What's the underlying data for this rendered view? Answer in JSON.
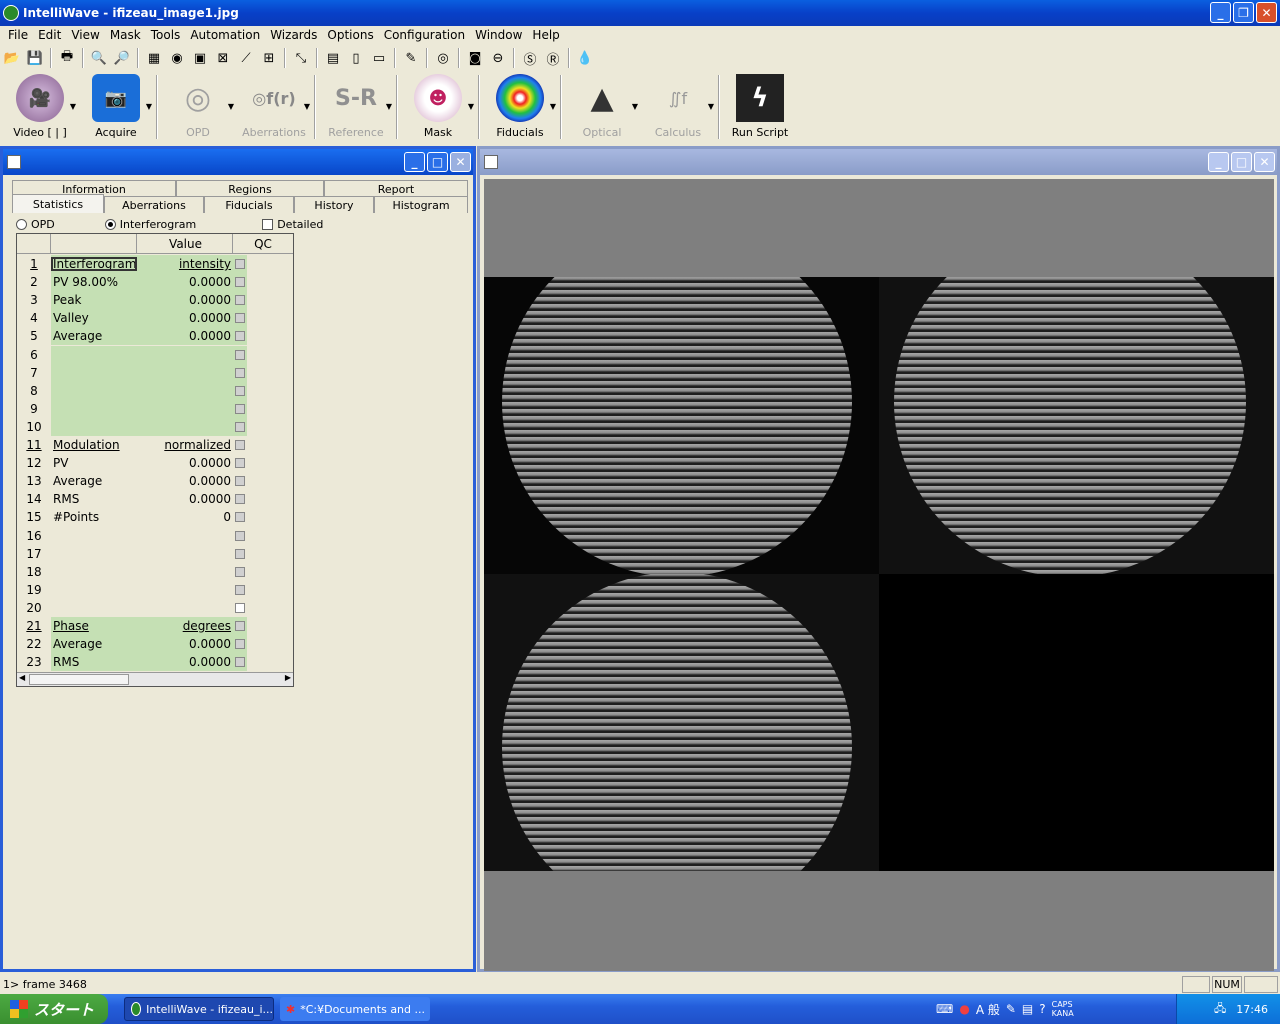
{
  "window": {
    "title": "IntelliWave - ifizeau_image1.jpg"
  },
  "menu": [
    "File",
    "Edit",
    "View",
    "Mask",
    "Tools",
    "Automation",
    "Wizards",
    "Options",
    "Configuration",
    "Window",
    "Help"
  ],
  "big_toolbar": [
    {
      "label": "Video [ | ]",
      "icon": "video-camera-icon",
      "enabled": true
    },
    {
      "label": "Acquire",
      "icon": "camera-icon",
      "enabled": true
    },
    {
      "label": "OPD",
      "icon": "opd-icon",
      "enabled": false
    },
    {
      "label": "Aberrations",
      "icon": "aberrations-icon",
      "enabled": false
    },
    {
      "label": "Reference",
      "icon": "reference-icon",
      "icon_text": "S-R",
      "enabled": false
    },
    {
      "label": "Mask",
      "icon": "mask-icon",
      "enabled": true
    },
    {
      "label": "Fiducials",
      "icon": "fiducials-icon",
      "enabled": true
    },
    {
      "label": "Optical",
      "icon": "optical-icon",
      "enabled": false
    },
    {
      "label": "Calculus",
      "icon": "calculus-icon",
      "enabled": false
    },
    {
      "label": "Run Script",
      "icon": "lightning-icon",
      "enabled": true
    }
  ],
  "stats_panel": {
    "tabs_back": [
      "Information",
      "Regions",
      "Report"
    ],
    "tabs_front": [
      "Statistics",
      "Aberrations",
      "Fiducials",
      "History",
      "Histogram"
    ],
    "active_tab": "Statistics",
    "radio_opd": "OPD",
    "radio_interferogram": "Interferogram",
    "radio_selected": "Interferogram",
    "detailed_label": "Detailed",
    "detailed_checked": false,
    "columns": [
      "Value",
      "QC"
    ],
    "rows": [
      {
        "n": "1",
        "name": "Interferogram",
        "value": "intensity",
        "header": true,
        "group": "green"
      },
      {
        "n": "2",
        "name": "PV 98.00%",
        "value": "0.0000",
        "group": "green"
      },
      {
        "n": "3",
        "name": "Peak",
        "value": "0.0000",
        "group": "green"
      },
      {
        "n": "4",
        "name": "Valley",
        "value": "0.0000",
        "group": "green"
      },
      {
        "n": "5",
        "name": "Average",
        "value": "0.0000",
        "group": "green"
      },
      {
        "n": "6",
        "name": "",
        "value": "",
        "group": "green"
      },
      {
        "n": "7",
        "name": "",
        "value": "",
        "group": "green"
      },
      {
        "n": "8",
        "name": "",
        "value": "",
        "group": "green"
      },
      {
        "n": "9",
        "name": "",
        "value": "",
        "group": "green"
      },
      {
        "n": "10",
        "name": "",
        "value": "",
        "group": "green"
      },
      {
        "n": "11",
        "name": "Modulation",
        "value": "normalized",
        "header": true,
        "group": "beige"
      },
      {
        "n": "12",
        "name": "PV",
        "value": "0.0000",
        "group": "beige"
      },
      {
        "n": "13",
        "name": "Average",
        "value": "0.0000",
        "group": "beige"
      },
      {
        "n": "14",
        "name": "RMS",
        "value": "0.0000",
        "group": "beige"
      },
      {
        "n": "15",
        "name": "#Points",
        "value": "0",
        "group": "beige"
      },
      {
        "n": "16",
        "name": "",
        "value": "",
        "group": "beige"
      },
      {
        "n": "17",
        "name": "",
        "value": "",
        "group": "beige"
      },
      {
        "n": "18",
        "name": "",
        "value": "",
        "group": "beige"
      },
      {
        "n": "19",
        "name": "",
        "value": "",
        "group": "beige"
      },
      {
        "n": "20",
        "name": "",
        "value": "",
        "group": "beige",
        "qc_white": true
      },
      {
        "n": "21",
        "name": "Phase",
        "value": "degrees",
        "header": true,
        "group": "green"
      },
      {
        "n": "22",
        "name": "Average",
        "value": "0.0000",
        "group": "green"
      },
      {
        "n": "23",
        "name": "RMS",
        "value": "0.0000",
        "group": "green"
      }
    ]
  },
  "statusbar": {
    "text": "1> frame 3468",
    "num": "NUM"
  },
  "taskbar": {
    "start": "スタート",
    "tasks": [
      "IntelliWave - ifizeau_i...",
      "*C:¥Documents and ..."
    ],
    "tray_ime": "A 般",
    "caps": "CAPS",
    "kana": "KANA",
    "clock": "17:46"
  },
  "colors": {
    "green_group": "#c5e0b4",
    "title_blue": "#0a5fe0",
    "image_bg": "#7f7f7f"
  }
}
